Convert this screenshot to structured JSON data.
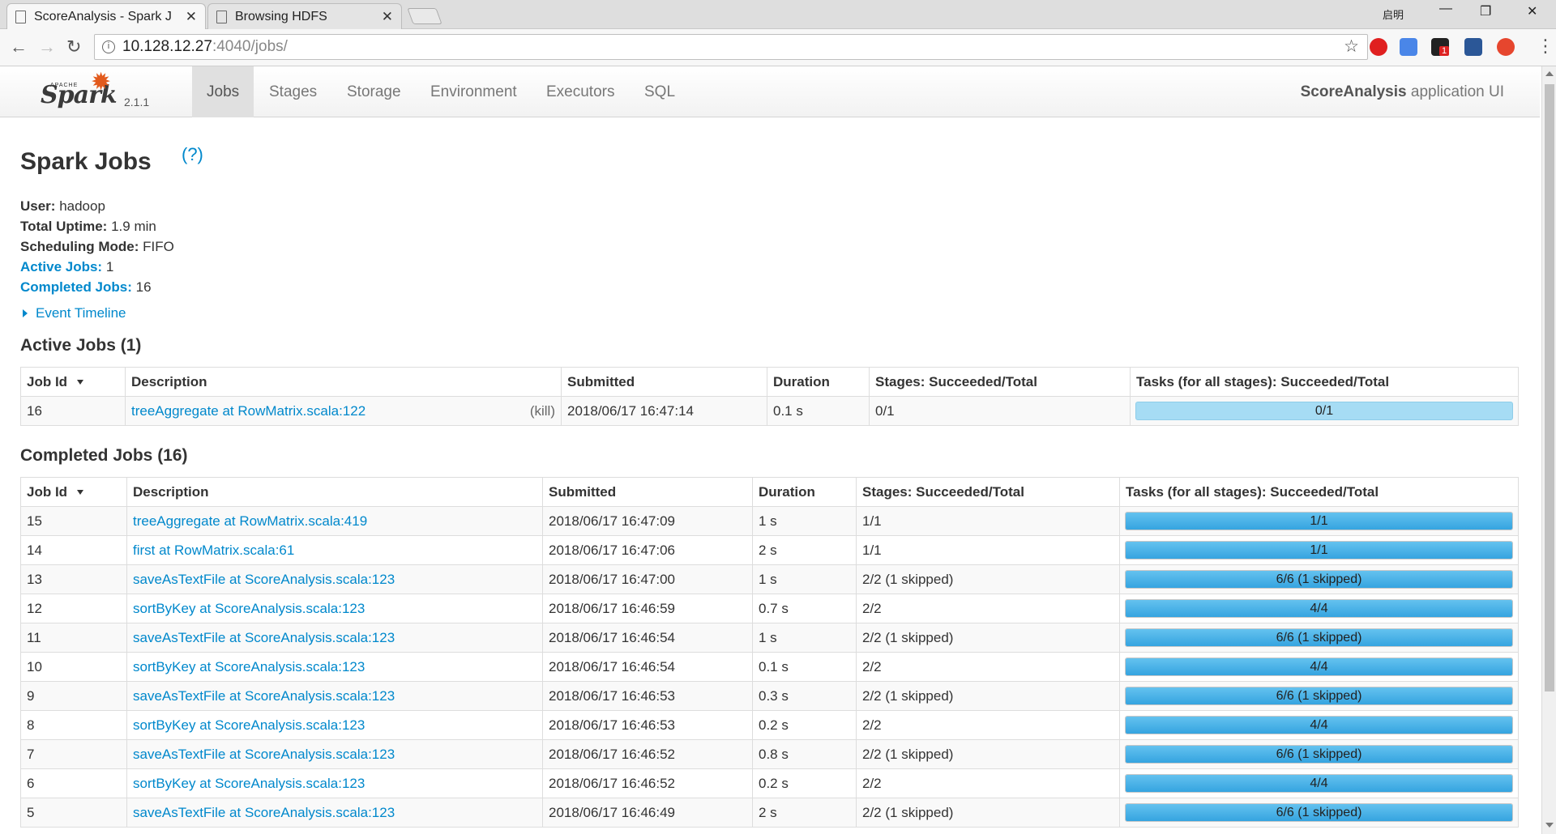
{
  "browser": {
    "tabs": [
      {
        "title": "ScoreAnalysis - Spark J",
        "active": true
      },
      {
        "title": "Browsing HDFS",
        "active": false
      }
    ],
    "window_controls": {
      "restore_label": "启明"
    },
    "url": {
      "host": "10.128.12.27",
      "rest": ":4040/jobs/"
    },
    "extension_badge": "1"
  },
  "navbar": {
    "logo_apache": "APACHE",
    "logo_spark": "Spark",
    "version": "2.1.1",
    "tabs": [
      "Jobs",
      "Stages",
      "Storage",
      "Environment",
      "Executors",
      "SQL"
    ],
    "active_tab": "Jobs",
    "app_name": "ScoreAnalysis",
    "app_suffix": " application UI"
  },
  "page": {
    "title": "Spark Jobs",
    "help": "(?)",
    "summary": {
      "user_label": "User:",
      "user": " hadoop",
      "uptime_label": "Total Uptime:",
      "uptime": " 1.9 min",
      "mode_label": "Scheduling Mode:",
      "mode": " FIFO",
      "active_label": "Active Jobs:",
      "active": " 1",
      "completed_label": "Completed Jobs:",
      "completed": " 16"
    },
    "event_timeline": "Event Timeline"
  },
  "table_headers": [
    "Job Id",
    "Description",
    "Submitted",
    "Duration",
    "Stages: Succeeded/Total",
    "Tasks (for all stages): Succeeded/Total"
  ],
  "active_jobs": {
    "heading": "Active Jobs (1)",
    "kill_label": "(kill)",
    "rows": [
      {
        "id": "16",
        "desc": "treeAggregate at RowMatrix.scala:122",
        "submitted": "2018/06/17 16:47:14",
        "duration": "0.1 s",
        "stages": "0/1",
        "tasks": "0/1",
        "progress": 0
      }
    ]
  },
  "completed_jobs": {
    "heading": "Completed Jobs (16)",
    "rows": [
      {
        "id": "15",
        "desc": "treeAggregate at RowMatrix.scala:419",
        "submitted": "2018/06/17 16:47:09",
        "duration": "1 s",
        "stages": "1/1",
        "tasks": "1/1",
        "progress": 1
      },
      {
        "id": "14",
        "desc": "first at RowMatrix.scala:61",
        "submitted": "2018/06/17 16:47:06",
        "duration": "2 s",
        "stages": "1/1",
        "tasks": "1/1",
        "progress": 1
      },
      {
        "id": "13",
        "desc": "saveAsTextFile at ScoreAnalysis.scala:123",
        "submitted": "2018/06/17 16:47:00",
        "duration": "1 s",
        "stages": "2/2 (1 skipped)",
        "tasks": "6/6 (1 skipped)",
        "progress": 1
      },
      {
        "id": "12",
        "desc": "sortByKey at ScoreAnalysis.scala:123",
        "submitted": "2018/06/17 16:46:59",
        "duration": "0.7 s",
        "stages": "2/2",
        "tasks": "4/4",
        "progress": 1
      },
      {
        "id": "11",
        "desc": "saveAsTextFile at ScoreAnalysis.scala:123",
        "submitted": "2018/06/17 16:46:54",
        "duration": "1 s",
        "stages": "2/2 (1 skipped)",
        "tasks": "6/6 (1 skipped)",
        "progress": 1
      },
      {
        "id": "10",
        "desc": "sortByKey at ScoreAnalysis.scala:123",
        "submitted": "2018/06/17 16:46:54",
        "duration": "0.1 s",
        "stages": "2/2",
        "tasks": "4/4",
        "progress": 1
      },
      {
        "id": "9",
        "desc": "saveAsTextFile at ScoreAnalysis.scala:123",
        "submitted": "2018/06/17 16:46:53",
        "duration": "0.3 s",
        "stages": "2/2 (1 skipped)",
        "tasks": "6/6 (1 skipped)",
        "progress": 1
      },
      {
        "id": "8",
        "desc": "sortByKey at ScoreAnalysis.scala:123",
        "submitted": "2018/06/17 16:46:53",
        "duration": "0.2 s",
        "stages": "2/2",
        "tasks": "4/4",
        "progress": 1
      },
      {
        "id": "7",
        "desc": "saveAsTextFile at ScoreAnalysis.scala:123",
        "submitted": "2018/06/17 16:46:52",
        "duration": "0.8 s",
        "stages": "2/2 (1 skipped)",
        "tasks": "6/6 (1 skipped)",
        "progress": 1
      },
      {
        "id": "6",
        "desc": "sortByKey at ScoreAnalysis.scala:123",
        "submitted": "2018/06/17 16:46:52",
        "duration": "0.2 s",
        "stages": "2/2",
        "tasks": "4/4",
        "progress": 1
      },
      {
        "id": "5",
        "desc": "saveAsTextFile at ScoreAnalysis.scala:123",
        "submitted": "2018/06/17 16:46:49",
        "duration": "2 s",
        "stages": "2/2 (1 skipped)",
        "tasks": "6/6 (1 skipped)",
        "progress": 1
      }
    ]
  },
  "colors": {
    "link": "#0088cc",
    "progress_complete": "#35a4e0",
    "progress_running": "#a6dcf4",
    "spark_orange": "#e25a1c"
  }
}
